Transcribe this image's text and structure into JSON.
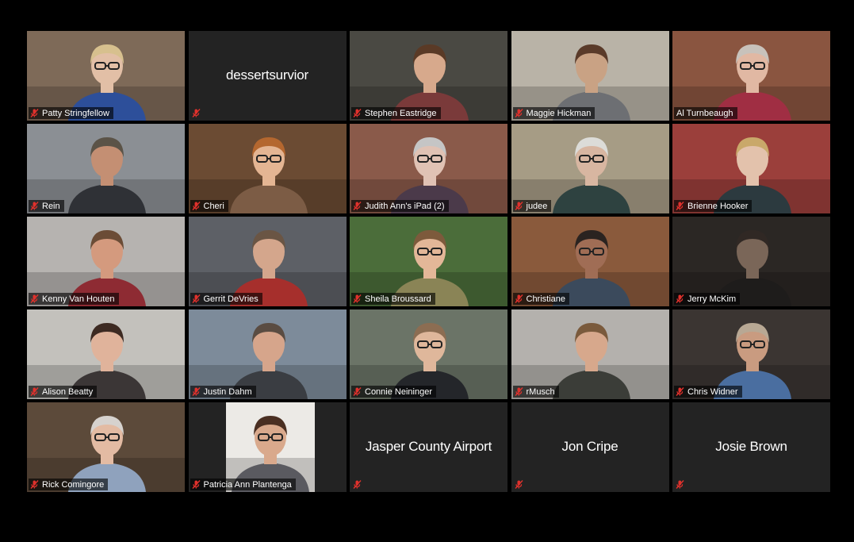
{
  "meeting": {
    "view": "gallery",
    "accent_speaker_border": "#d9e38a",
    "muted_icon_color": "#e0312c",
    "participants": [
      {
        "name": "Patty Stringfellow",
        "muted": true,
        "video": true,
        "bg": "#7e6a58",
        "skin": "#e2bfa6",
        "shirt": "#2d4f9a",
        "hair": "#d7c08e",
        "glasses": true
      },
      {
        "name": "dessertsurvior",
        "muted": true,
        "video": false
      },
      {
        "name": "Stephen Eastridge",
        "muted": true,
        "video": true,
        "bg": "#4a4943",
        "skin": "#d7a98c",
        "shirt": "#7a3a3a",
        "hair": "#5a3a26",
        "glasses": false
      },
      {
        "name": "Maggie Hickman",
        "muted": true,
        "video": true,
        "bg": "#b9b3a7",
        "skin": "#c9a284",
        "shirt": "#6d6f73",
        "hair": "#5a3b2a",
        "glasses": false
      },
      {
        "name": "Al Turnbeaugh",
        "muted": false,
        "video": true,
        "active_speaker": true,
        "bg": "#8a5540",
        "skin": "#e1b8a3",
        "shirt": "#a02e43",
        "hair": "#c8c2bb",
        "glasses": true
      },
      {
        "name": "Rein",
        "muted": true,
        "video": true,
        "bg": "#8b8f94",
        "skin": "#c48f73",
        "shirt": "#2f3136",
        "hair": "#5b5347",
        "glasses": false
      },
      {
        "name": "Cheri",
        "muted": true,
        "video": true,
        "bg": "#6b4b33",
        "skin": "#e4b593",
        "shirt": "#7c5c45",
        "hair": "#b4672f",
        "glasses": true
      },
      {
        "name": "Judith Ann's iPad (2)",
        "muted": true,
        "video": true,
        "bg": "#8a5a4a",
        "skin": "#e0c2b4",
        "shirt": "#4b3a4a",
        "hair": "#c5c5c5",
        "glasses": true
      },
      {
        "name": "judee",
        "muted": true,
        "video": true,
        "bg": "#a69c85",
        "skin": "#d8b6a1",
        "shirt": "#2e4240",
        "hair": "#dcdcd8",
        "glasses": true
      },
      {
        "name": "Brienne Hooker",
        "muted": true,
        "video": true,
        "bg": "#9b3f3b",
        "skin": "#e3c2ac",
        "shirt": "#2c3a3f",
        "hair": "#c9a86a",
        "glasses": false
      },
      {
        "name": "Kenny Van Houten",
        "muted": true,
        "video": true,
        "bg": "#b6b3b0",
        "skin": "#d49a7e",
        "shirt": "#8e2b33",
        "hair": "#6b4c36",
        "glasses": false
      },
      {
        "name": "Gerrit DeVries",
        "muted": true,
        "video": true,
        "bg": "#5d6066",
        "skin": "#d4a68c",
        "shirt": "#a62f2c",
        "hair": "#6a5544",
        "glasses": false
      },
      {
        "name": "Sheila Broussard",
        "muted": true,
        "video": true,
        "bg": "#4b6d3a",
        "skin": "#e3b798",
        "shirt": "#8a8456",
        "hair": "#7d5a3c",
        "glasses": true
      },
      {
        "name": "Christiane",
        "muted": true,
        "video": true,
        "bg": "#8a5a3c",
        "skin": "#a06d55",
        "shirt": "#3b4a5c",
        "hair": "#2a2320",
        "glasses": true
      },
      {
        "name": "Jerry McKim",
        "muted": true,
        "video": true,
        "bg": "#2b2724",
        "skin": "#7a6658",
        "shirt": "#1e1c1b",
        "hair": "#302824",
        "glasses": false
      },
      {
        "name": "Alison Beatty",
        "muted": true,
        "video": true,
        "bg": "#c3c1bc",
        "skin": "#e0b39b",
        "shirt": "#3b3636",
        "hair": "#3d2a22",
        "glasses": false
      },
      {
        "name": "Justin Dahm",
        "muted": true,
        "video": true,
        "bg": "#7d8b9a",
        "skin": "#d6a58b",
        "shirt": "#3a3d42",
        "hair": "#5a4c42",
        "glasses": false
      },
      {
        "name": "Connie Neininger",
        "muted": true,
        "video": true,
        "bg": "#6b7467",
        "skin": "#dfb79b",
        "shirt": "#24262a",
        "hair": "#8c6d52",
        "glasses": true
      },
      {
        "name": "rMusch",
        "muted": true,
        "video": true,
        "bg": "#b4b1ad",
        "skin": "#d7a88c",
        "shirt": "#3b3d38",
        "hair": "#7a5a3c",
        "glasses": false
      },
      {
        "name": "Chris Widner",
        "muted": true,
        "video": true,
        "bg": "#3b3532",
        "skin": "#c99b80",
        "shirt": "#4a6ea0",
        "hair": "#b8a894",
        "glasses": true
      },
      {
        "name": "Rick Comingore",
        "muted": true,
        "video": true,
        "bg": "#5c4a3a",
        "skin": "#e3bba3",
        "shirt": "#8fa2bd",
        "hair": "#d6d2ce",
        "glasses": true
      },
      {
        "name": "Patricia Ann Plantenga",
        "muted": true,
        "video": false,
        "photo": true,
        "bg": "#eceae6",
        "skin": "#d9a98c",
        "shirt": "#5a5a60",
        "hair": "#4a2f22",
        "glasses": true
      },
      {
        "name": "Jasper County Airport",
        "muted": true,
        "video": false
      },
      {
        "name": "Jon Cripe",
        "muted": true,
        "video": false
      },
      {
        "name": "Josie Brown",
        "muted": true,
        "video": false
      }
    ]
  }
}
